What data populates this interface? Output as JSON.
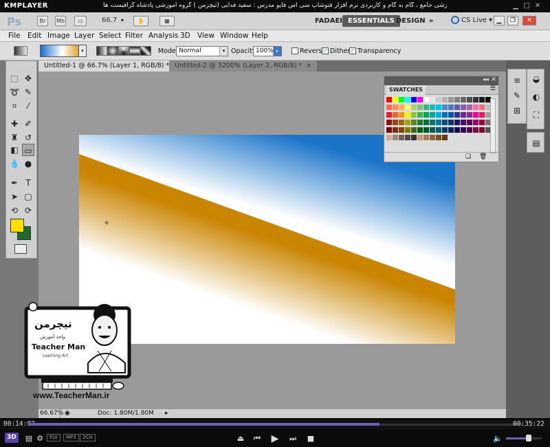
{
  "player": {
    "brand": "KMPLAYER",
    "title": "مجموعه آموزشی جامع ، گام به گام و کاربردی نرم افزار فتوشاپ سی اس فایو  مدرس : سعید فدایی (تیچرمن ) گروه آموزشی پادشاه گرافیست ها",
    "time_elapsed": "00:14:02",
    "time_total": "00:35:22",
    "progress_fraction": 0.711,
    "volume_fraction": 0.6,
    "badge_3d": "3D",
    "formats": [
      "FLV",
      "MP3",
      "2CH"
    ]
  },
  "photoshop": {
    "logo": "Ps",
    "appbar": {
      "br": "Br",
      "mb": "Mb",
      "zoom": "66.7",
      "zoom_arrow": "▾"
    },
    "workspaces": [
      "FADAEI",
      "ESSENTIALS",
      "DESIGN"
    ],
    "workspace_more": "»",
    "cs_live": "CS Live",
    "menu": [
      "File",
      "Edit",
      "Image",
      "Layer",
      "Select",
      "Filter",
      "Analysis",
      "3D",
      "View",
      "Window",
      "Help"
    ],
    "options": {
      "mode_label": "Mode:",
      "mode_value": "Normal",
      "opacity_label": "Opacity:",
      "opacity_value": "100%",
      "reverse_label": "Reverse",
      "dither_label": "Dither",
      "transparency_label": "Transparency",
      "reverse_checked": false,
      "dither_checked": true,
      "transparency_checked": true
    },
    "tabs": [
      {
        "label": "Untitled-1 @ 66.7% (Layer 1, RGB/8) *",
        "active": true
      },
      {
        "label": "Untitled-2 @ 3200% (Layer 2, RGB/8) *",
        "active": false
      }
    ],
    "tab_close": "×",
    "swatches_title": "SWATCHES",
    "status": {
      "zoom": "66.67%",
      "doc": "Doc: 1.80M/1.80M"
    },
    "colors": {
      "foreground": "#ffe000",
      "background": "#1f6a2a",
      "gradient_blue": "#1a74c8",
      "gradient_gold": "#d18b00"
    }
  },
  "watermark": {
    "brand_fa": "تیچرمن",
    "sub_fa": "واحد آموزش",
    "brand_en": "Teacher Man",
    "tagline": "Learning Art",
    "url": "www.TeacherMan.ir"
  }
}
